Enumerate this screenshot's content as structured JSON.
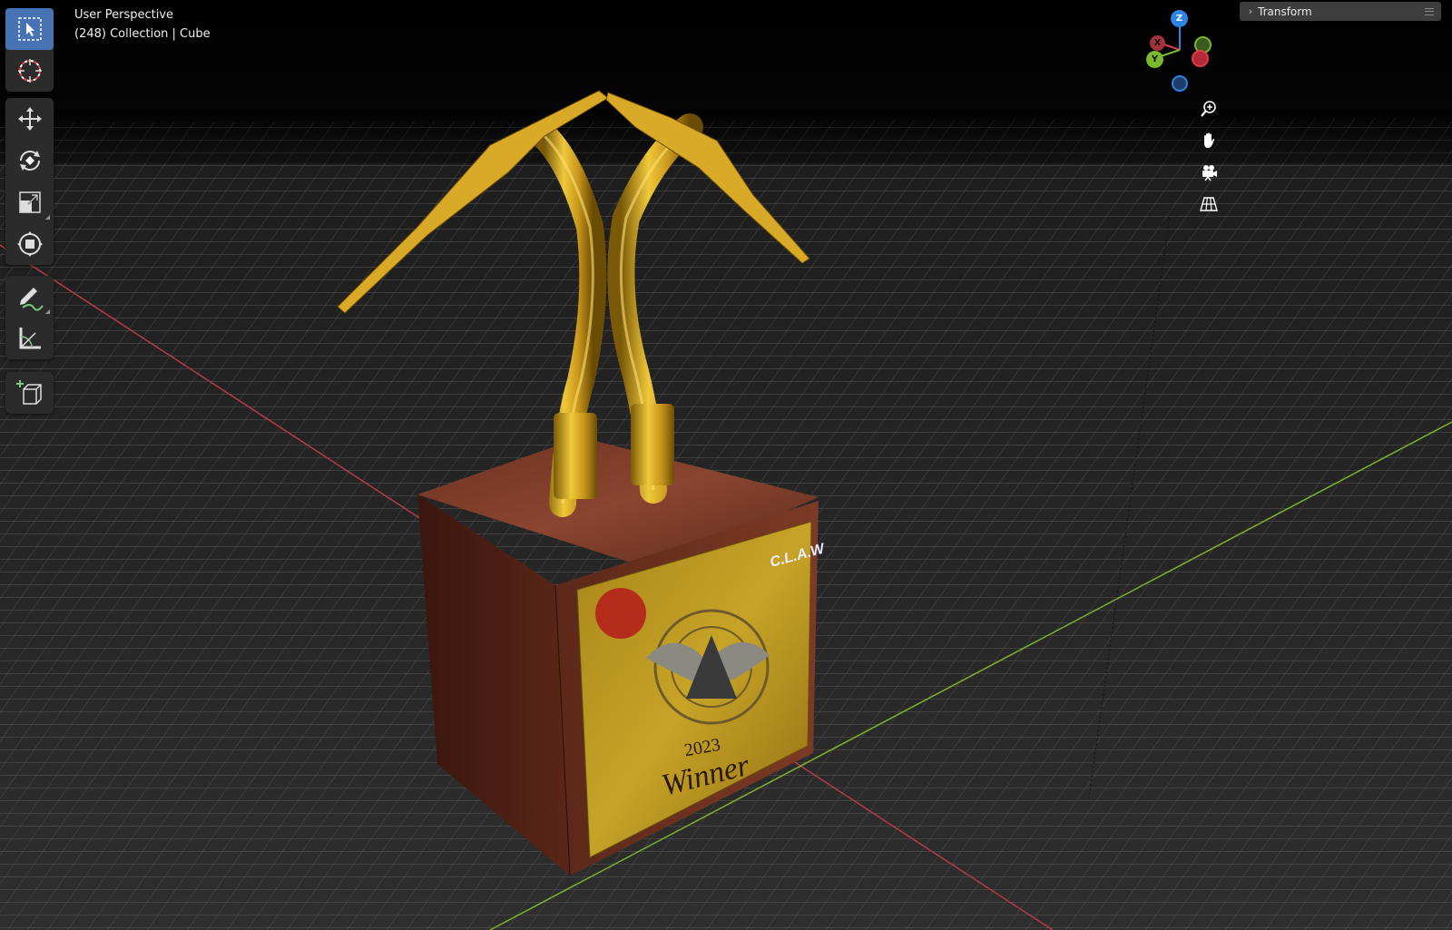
{
  "viewport": {
    "view_name": "User Perspective",
    "context_line": "(248) Collection | Cube"
  },
  "panel": {
    "transform_label": "Transform"
  },
  "gizmo": {
    "z_label": "Z",
    "x_label": "X",
    "y_label": "Y",
    "colors": {
      "z": "#2f84e3",
      "x": "#e03a4a",
      "y": "#7ab82d"
    }
  },
  "plaque": {
    "logo_text": "C.L.A.W",
    "year": "2023",
    "title": "Winner"
  },
  "toolbar": {
    "tools": [
      "select-box",
      "cursor",
      "move",
      "rotate",
      "scale",
      "transform",
      "annotate",
      "measure",
      "add-cube"
    ],
    "active_tool": "select-box"
  },
  "colors": {
    "accent": "#4772b3",
    "x_axis_line": "#b83a4a",
    "y_axis_line": "#7fb02e",
    "gold": "#c8a020",
    "wood": "#5a2a1c"
  }
}
